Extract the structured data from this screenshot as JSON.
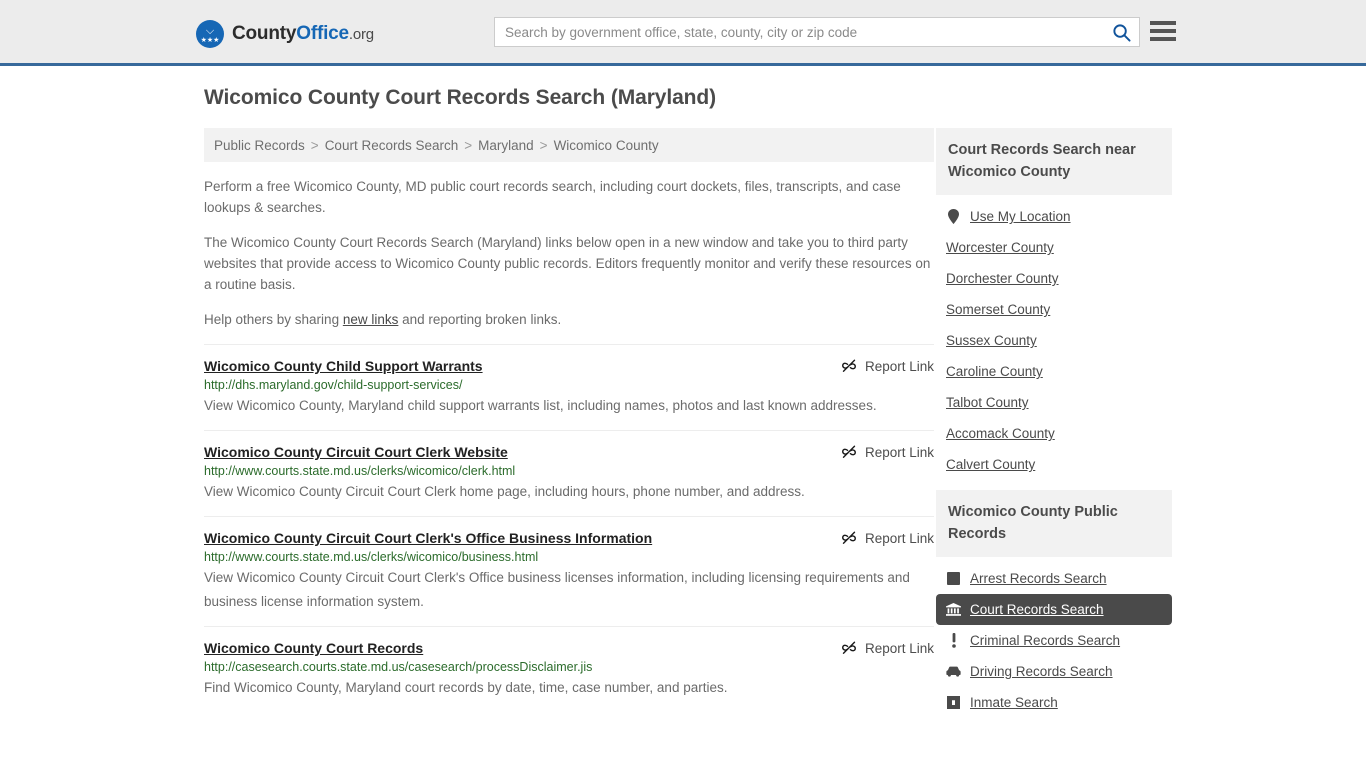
{
  "header": {
    "logo": {
      "text_1": "County",
      "text_2": "Office",
      "text_3": ".org",
      "icon": "eagle-seal-logo"
    },
    "search": {
      "placeholder": "Search by government office, state, county, city or zip code",
      "value": "",
      "button_icon": "search-icon"
    },
    "menu_icon": "hamburger-menu-icon",
    "accent_color": "#37699b",
    "background": "#ececec"
  },
  "page": {
    "title": "Wicomico County Court Records Search (Maryland)"
  },
  "breadcrumb": {
    "items": [
      "Public Records",
      "Court Records Search",
      "Maryland",
      "Wicomico County"
    ],
    "separator": ">"
  },
  "intro": {
    "p1": "Perform a free Wicomico County, MD public court records search, including court dockets, files, transcripts, and case lookups & searches.",
    "p2": "The Wicomico County Court Records Search (Maryland) links below open in a new window and take you to third party websites that provide access to Wicomico County public records. Editors frequently monitor and verify these resources on a routine basis.",
    "p3_before": "Help others by sharing ",
    "p3_link": "new links",
    "p3_after": " and reporting broken links."
  },
  "report_label": "Report Link",
  "report_icon": "broken-link-icon",
  "results": [
    {
      "title": "Wicomico County Child Support Warrants",
      "url": "http://dhs.maryland.gov/child-support-services/",
      "desc": "View Wicomico County, Maryland child support warrants list, including names, photos and last known addresses.",
      "report": "Report Link"
    },
    {
      "title": "Wicomico County Circuit Court Clerk Website",
      "url": "http://www.courts.state.md.us/clerks/wicomico/clerk.html",
      "desc": "View Wicomico County Circuit Court Clerk home page, including hours, phone number, and address.",
      "report": "Report Link"
    },
    {
      "title": "Wicomico County Circuit Court Clerk's Office Business Information",
      "url": "http://www.courts.state.md.us/clerks/wicomico/business.html",
      "desc": "View Wicomico County Circuit Court Clerk's Office business licenses information, including licensing requirements and business license information system.",
      "report": "Report Link"
    },
    {
      "title": "Wicomico County Court Records",
      "url": "http://casesearch.courts.state.md.us/casesearch/processDisclaimer.jis",
      "desc": "Find Wicomico County, Maryland court records by date, time, case number, and parties.",
      "report": "Report Link"
    }
  ],
  "sidebar": {
    "nearby": {
      "heading": "Court Records Search near Wicomico County",
      "items": [
        {
          "label": "Use My Location",
          "icon": "map-pin-icon"
        },
        {
          "label": "Worcester County",
          "icon": ""
        },
        {
          "label": "Dorchester County",
          "icon": ""
        },
        {
          "label": "Somerset County",
          "icon": ""
        },
        {
          "label": "Sussex County",
          "icon": ""
        },
        {
          "label": "Caroline County",
          "icon": ""
        },
        {
          "label": "Talbot County",
          "icon": ""
        },
        {
          "label": "Accomack County",
          "icon": ""
        },
        {
          "label": "Calvert County",
          "icon": ""
        }
      ]
    },
    "public_records": {
      "heading": "Wicomico County Public Records",
      "items": [
        {
          "label": "Arrest Records Search",
          "icon": "fingerprint-icon",
          "active": false
        },
        {
          "label": "Court Records Search",
          "icon": "courthouse-icon",
          "active": true
        },
        {
          "label": "Criminal Records Search",
          "icon": "exclamation-icon",
          "active": false
        },
        {
          "label": "Driving Records Search",
          "icon": "car-icon",
          "active": false
        },
        {
          "label": "Inmate Search",
          "icon": "jail-icon",
          "active": false
        }
      ]
    }
  }
}
